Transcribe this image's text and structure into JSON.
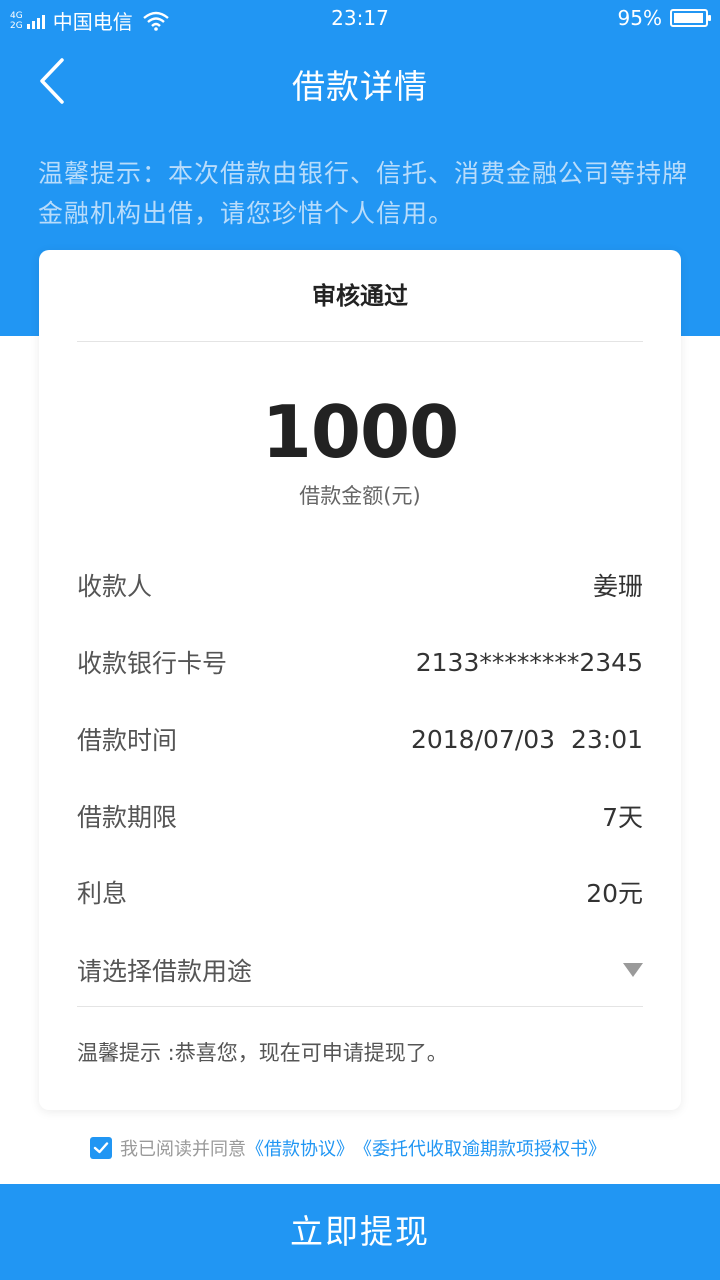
{
  "status_bar": {
    "network_top": "4G",
    "network_bottom": "2G",
    "carrier": "中国电信",
    "time": "23:17",
    "battery_text": "95%",
    "battery_level": 0.95
  },
  "nav": {
    "title": "借款详情"
  },
  "tip_top": "温馨提示：本次借款由银行、信托、消费金融公司等持牌金融机构出借，请您珍惜个人信用。",
  "card": {
    "status": "审核通过",
    "amount": "1000",
    "amount_label": "借款金额(元)",
    "rows": [
      {
        "label": "收款人",
        "value": "姜珊"
      },
      {
        "label": "收款银行卡号",
        "value": "2133********2345"
      },
      {
        "label": "借款时间",
        "value": "2018/07/03  23:01"
      },
      {
        "label": "借款期限",
        "value": "7天"
      },
      {
        "label": "利息",
        "value": "20元"
      }
    ],
    "purpose_placeholder": "请选择借款用途",
    "tip_bottom": "温馨提示 :恭喜您，现在可申请提现了。"
  },
  "agreement": {
    "checked": true,
    "text": "我已阅读并同意",
    "link1": "《借款协议》",
    "link2": "《委托代收取逾期款项授权书》"
  },
  "submit_label": "立即提现",
  "colors": {
    "primary": "#2196f3",
    "tip_text": "#b8dcfb"
  }
}
